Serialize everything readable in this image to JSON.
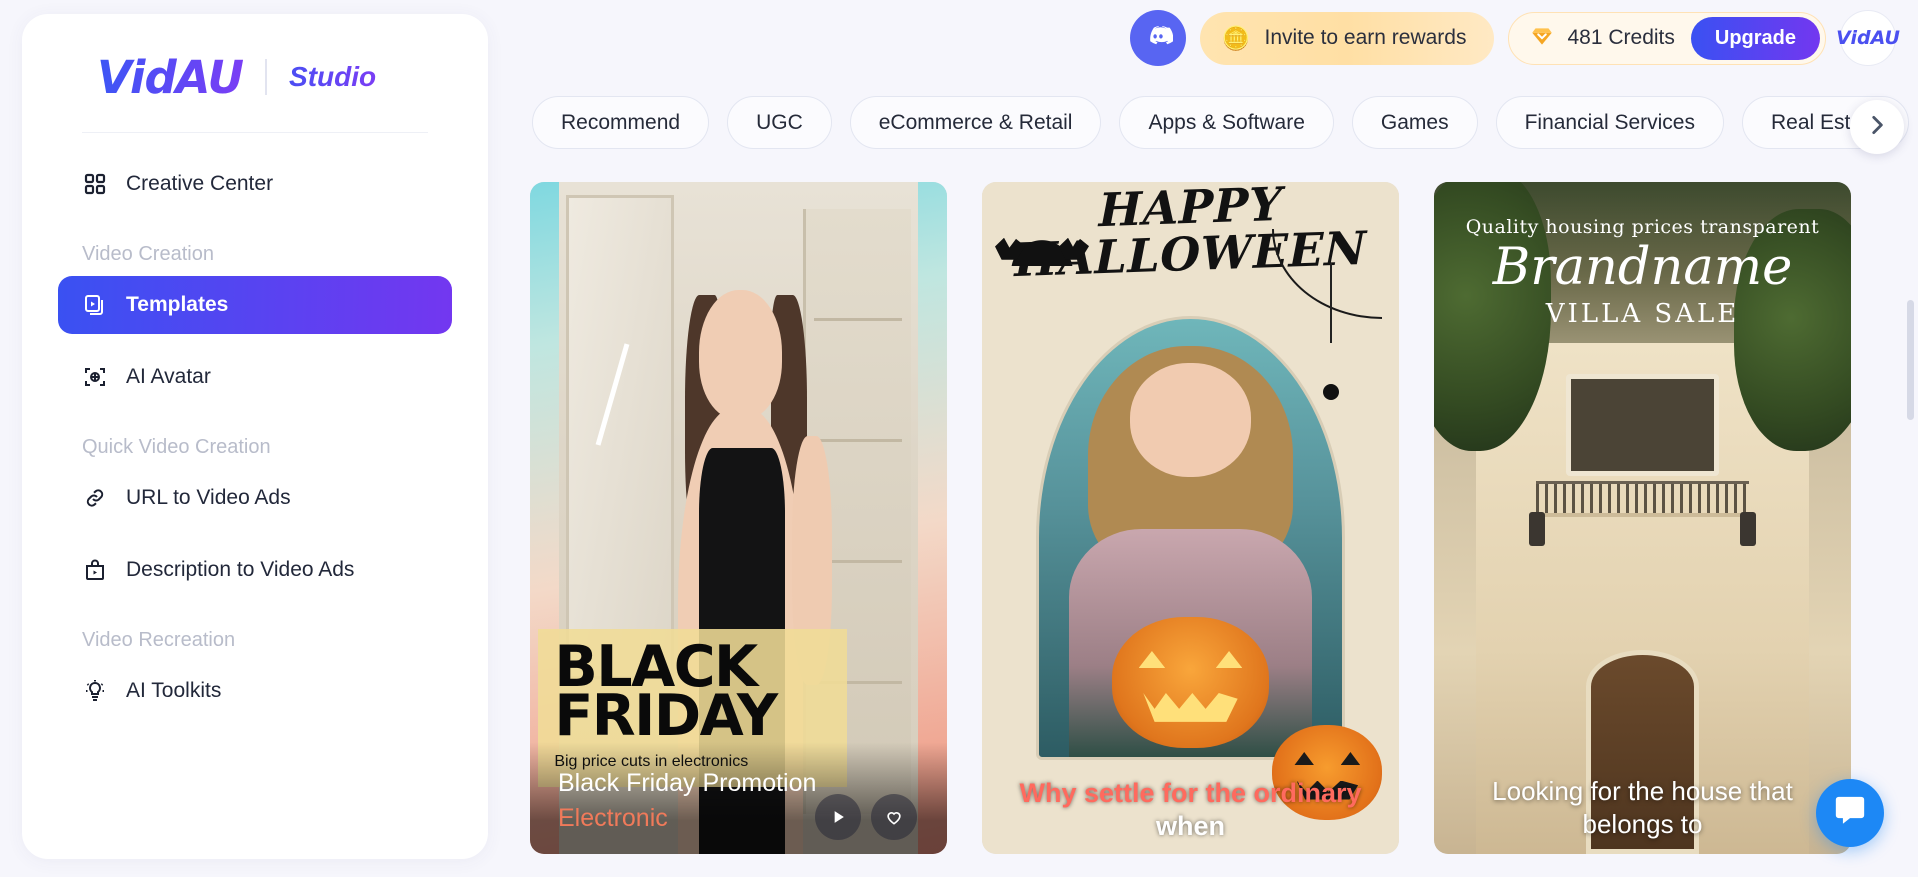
{
  "sidebar": {
    "brand": {
      "logo": "VidAU",
      "sub": "Studio"
    },
    "top_items": [
      {
        "label": "Creative Center",
        "icon": "grid-icon"
      }
    ],
    "groups": [
      {
        "label": "Video Creation",
        "items": [
          {
            "label": "Templates",
            "icon": "templates-icon",
            "active": true
          },
          {
            "label": "AI Avatar",
            "icon": "avatar-target-icon",
            "active": false
          }
        ]
      },
      {
        "label": "Quick Video Creation",
        "items": [
          {
            "label": "URL to Video Ads",
            "icon": "link-icon",
            "active": false
          },
          {
            "label": "Description to Video Ads",
            "icon": "bag-play-icon",
            "active": false
          }
        ]
      },
      {
        "label": "Video Recreation",
        "items": [
          {
            "label": "AI Toolkits",
            "icon": "lightbulb-icon",
            "active": false
          }
        ]
      }
    ]
  },
  "header": {
    "discord_icon": "discord-icon",
    "invite_label": "Invite to earn rewards",
    "invite_emoji": "🪙",
    "credits_label": "481 Credits",
    "credits_icon": "diamond-icon",
    "upgrade_label": "Upgrade",
    "avatar_label": "VidAU",
    "accent_color": "#4b50f0",
    "credit_color": "#f5a623"
  },
  "tabs": {
    "items": [
      {
        "label": "Recommend"
      },
      {
        "label": "UGC"
      },
      {
        "label": "eCommerce & Retail"
      },
      {
        "label": "Apps & Software"
      },
      {
        "label": "Games"
      },
      {
        "label": "Financial Services"
      },
      {
        "label": "Real Estate"
      }
    ],
    "next_icon": "chevron-right-icon"
  },
  "cards": [
    {
      "title": "Black Friday Promotion",
      "subtitle": "Electronic",
      "overlay_heading": "BLACK FRIDAY",
      "overlay_tagline": "Big price cuts in electronics"
    },
    {
      "title": "",
      "subtitle": "",
      "overlay_heading": "HAPPY HALLOWEEN",
      "caption_line1": "Why settle for the ordinary",
      "caption_line2": "when"
    },
    {
      "title": "",
      "subtitle": "",
      "kicker": "Quality housing prices transparent",
      "brand": "Brandname",
      "villa": "VILLA SALE",
      "caption_line1": "Looking for the house that",
      "caption_line2": "belongs to"
    }
  ],
  "chat": {
    "icon": "chat-icon"
  }
}
